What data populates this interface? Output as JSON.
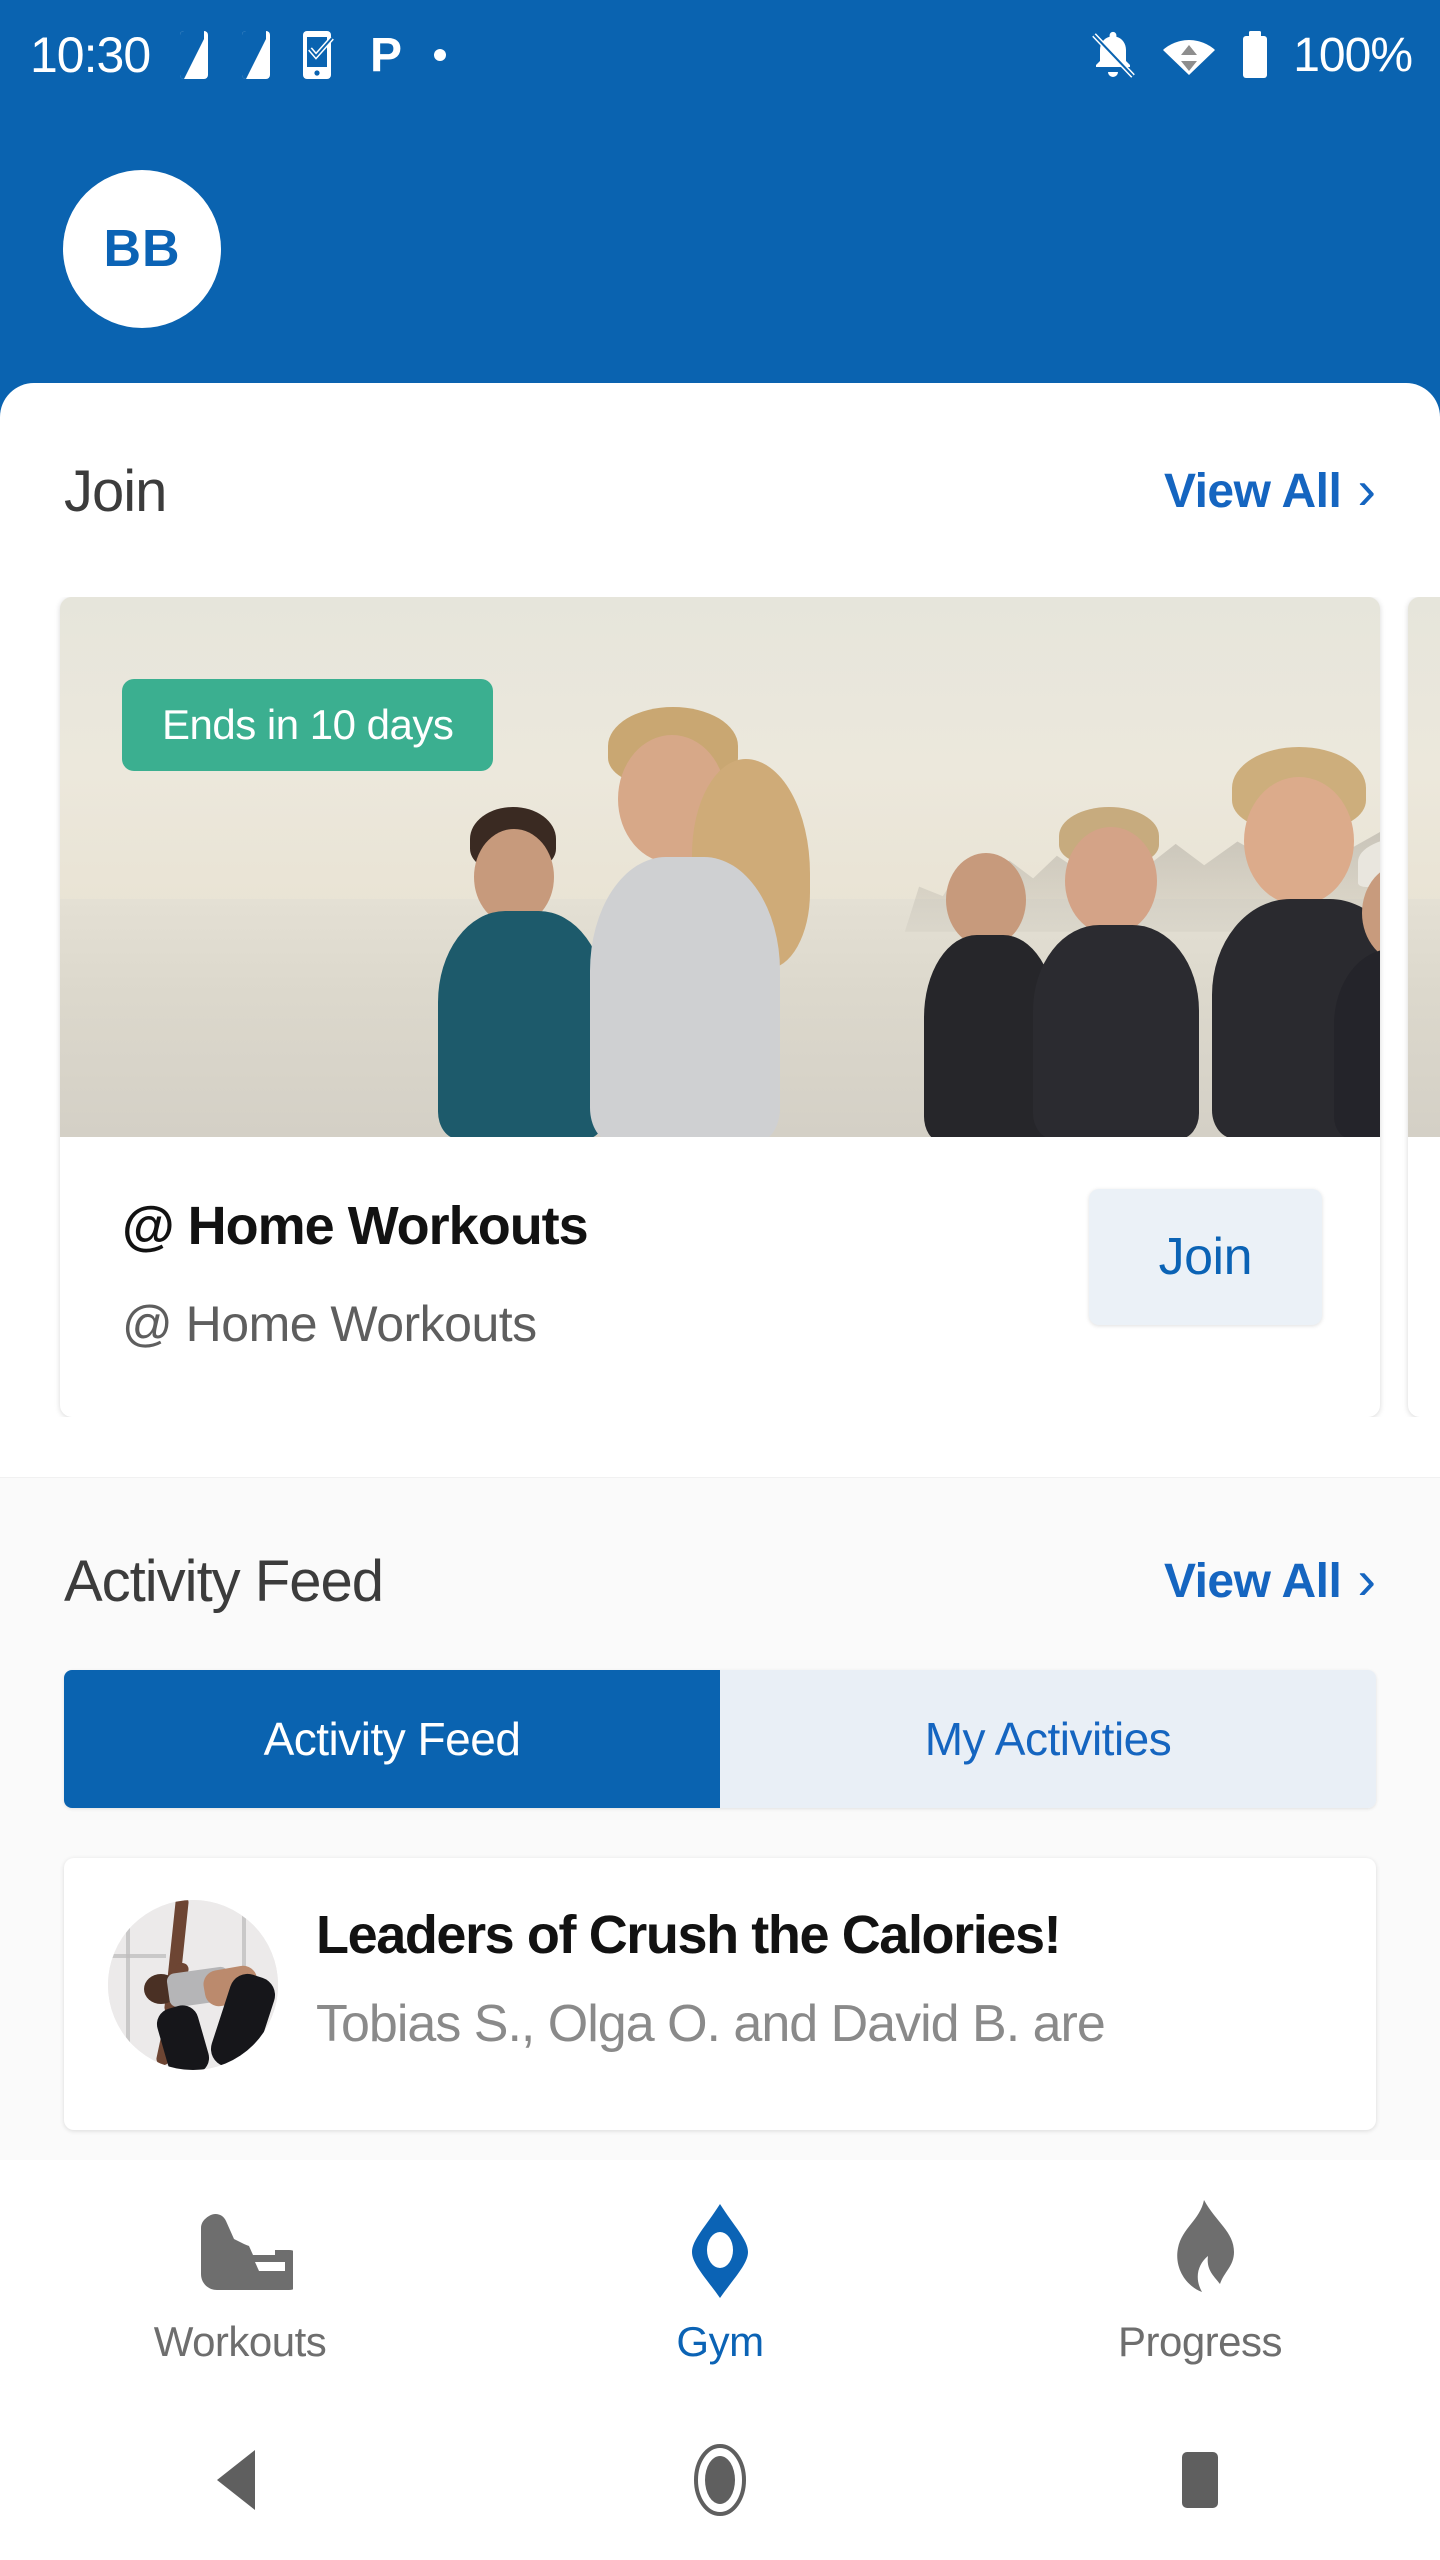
{
  "status_bar": {
    "time": "10:30",
    "battery_text": "100%",
    "left_icons": [
      "sim-card-icon",
      "sim-card-icon",
      "task-check-icon",
      "parking-p-icon",
      "dot-icon"
    ],
    "right_icons": [
      "notifications-off-icon",
      "wifi-transfer-icon",
      "battery-full-icon"
    ]
  },
  "header": {
    "avatar_initials": "BB"
  },
  "join_section": {
    "title": "Join",
    "view_all": "View All",
    "chevron": "›",
    "cards": [
      {
        "badge": "Ends in 10 days",
        "title": "@ Home Workouts",
        "subtitle": "@ Home Workouts",
        "action_label": "Join"
      }
    ]
  },
  "activity_section": {
    "title": "Activity Feed",
    "view_all": "View All",
    "chevron": "›",
    "tabs": [
      {
        "label": "Activity Feed",
        "active": true
      },
      {
        "label": "My Activities",
        "active": false
      }
    ],
    "feed_items": [
      {
        "avatar": "yoga-pose-photo",
        "title": "Leaders of Crush the Calories!",
        "subtitle": "Tobias S., Olga O. and David B. are"
      }
    ]
  },
  "tab_bar": {
    "tabs": [
      {
        "label": "Workouts",
        "icon": "running-shoe-icon",
        "active": false
      },
      {
        "label": "Gym",
        "icon": "location-pin-icon",
        "active": true
      },
      {
        "label": "Progress",
        "icon": "flame-icon",
        "active": false
      }
    ]
  },
  "system_nav": {
    "buttons": [
      "back-icon",
      "home-icon",
      "recents-icon"
    ]
  },
  "colors": {
    "brand_blue": "#0A63B0",
    "link_blue": "#1565C0",
    "badge_green": "#3BAF90",
    "join_btn_bg": "#EBF1F7",
    "tab_inactive_bg": "#E9EFF6"
  }
}
